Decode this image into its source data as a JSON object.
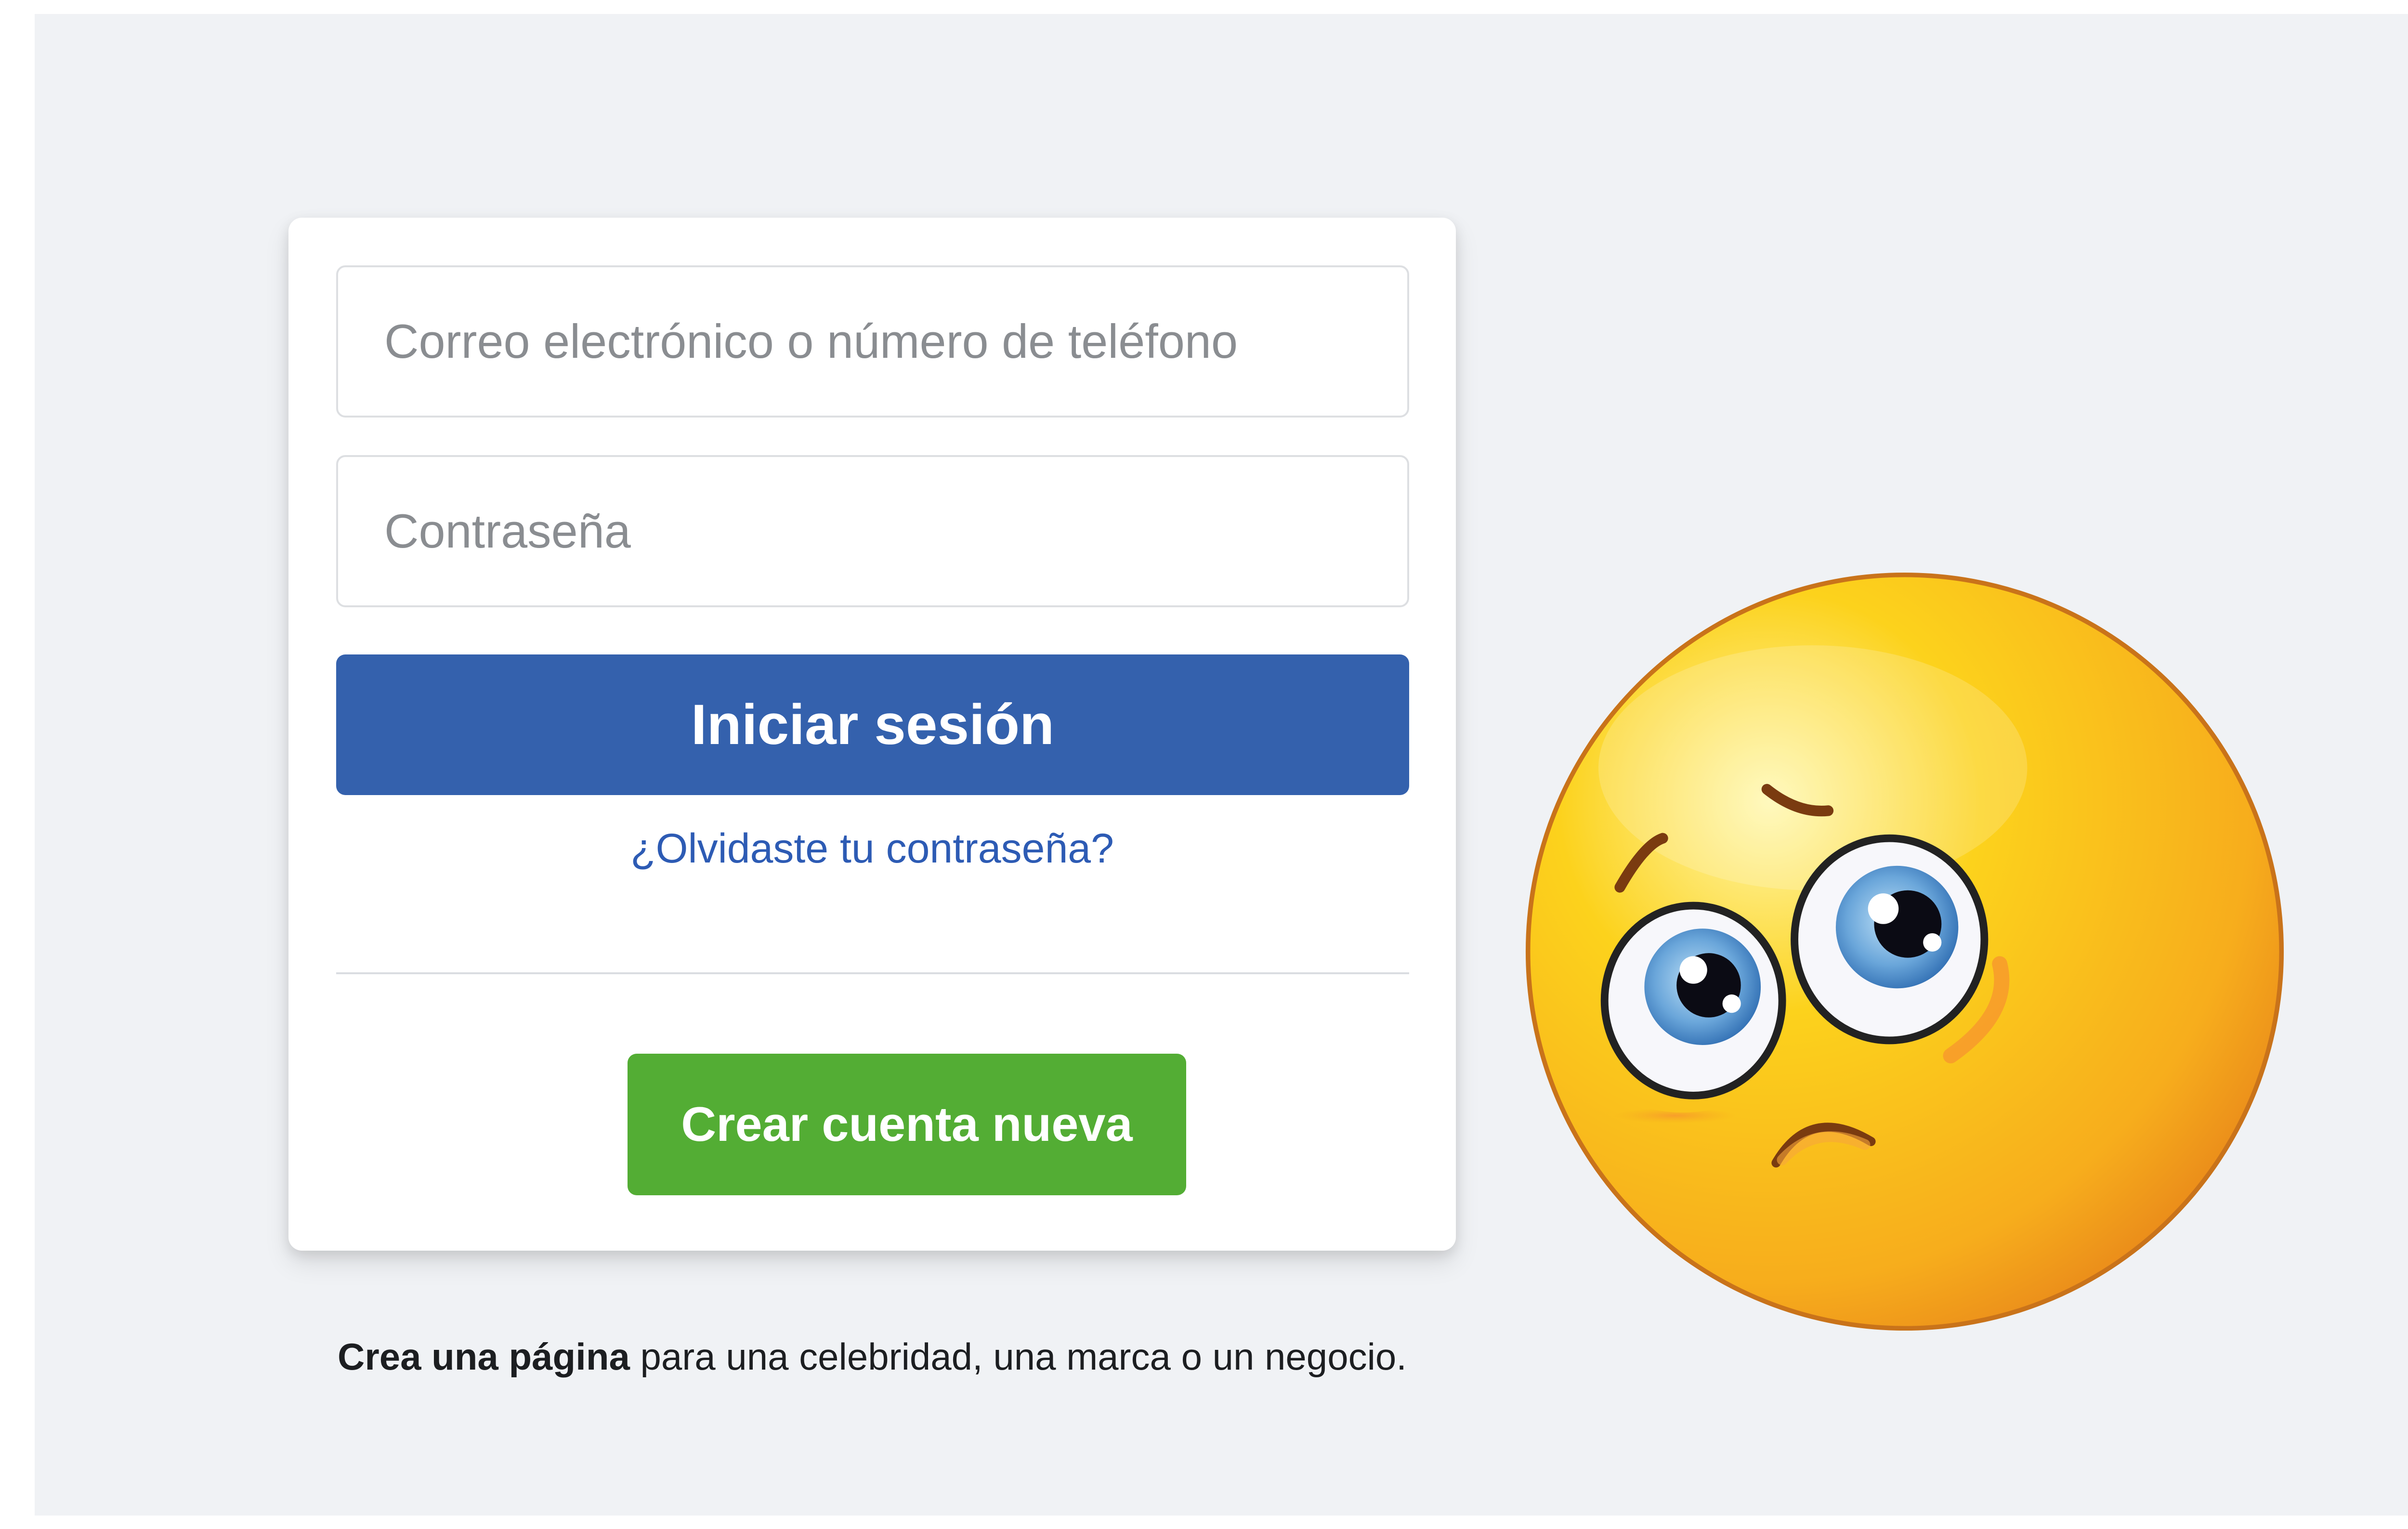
{
  "login_form": {
    "email_placeholder": "Correo electrónico o número de teléfono",
    "password_placeholder": "Contraseña",
    "login_button_label": "Iniciar sesión",
    "forgot_password_link": "¿Olvidaste tu contraseña?",
    "create_account_button_label": "Crear cuenta nueva"
  },
  "footer": {
    "create_page_link": "Crea una página",
    "create_page_text": " para una celebridad, una marca o un negocio."
  },
  "decoration": {
    "emoji": "sad-face"
  },
  "colors": {
    "background": "#f0f2f5",
    "primary_button": "#3461ad",
    "secondary_button": "#53ad34",
    "link": "#2d5bb4"
  }
}
